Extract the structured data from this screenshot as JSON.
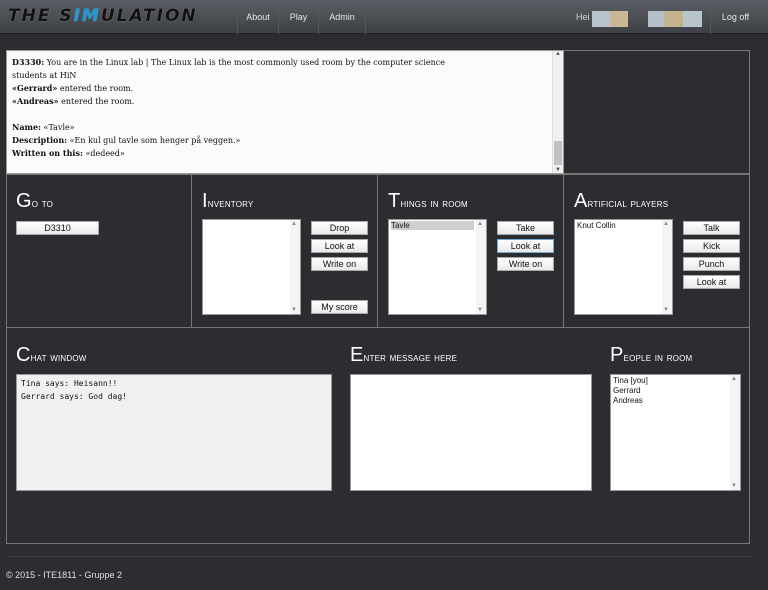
{
  "nav": {
    "brand_prefix": "THE S",
    "brand_accent": "IM",
    "brand_suffix": "ULATION",
    "items": [
      "About",
      "Play",
      "Admin"
    ],
    "greeting": "Hei",
    "logoff": "Log off"
  },
  "log": {
    "lines": [
      {
        "label": "D3330:",
        "text": " You are in the Linux lab | The Linux lab is the most commonly used room by the computer science"
      },
      {
        "label": "",
        "text": "students at HiN"
      },
      {
        "label": "«Gerrard»",
        "text": " entered the room."
      },
      {
        "label": "«Andreas»",
        "text": " entered the room."
      },
      {
        "label": "",
        "text": ""
      },
      {
        "label": "Name:",
        "text": " «Tavle»"
      },
      {
        "label": "Description:",
        "text": " «En kul gul tavle som henger på veggen.»"
      },
      {
        "label": "Written on this:",
        "text": " «dedeed»"
      }
    ]
  },
  "goto": {
    "title": "Go to",
    "destinations": [
      "D3310"
    ]
  },
  "inventory": {
    "title": "Inventory",
    "items": [],
    "buttons": {
      "drop": "Drop",
      "look_at": "Look at",
      "write_on": "Write on",
      "my_score": "My score"
    }
  },
  "things": {
    "title": "Things in room",
    "items": [
      "Tavle"
    ],
    "selected": "Tavle",
    "buttons": {
      "take": "Take",
      "look_at": "Look at",
      "write_on": "Write on"
    }
  },
  "ai_players": {
    "title": "Artificial players",
    "items": [
      "Knut Collin"
    ],
    "buttons": {
      "talk": "Talk",
      "kick": "Kick",
      "punch": "Punch",
      "look_at": "Look at"
    }
  },
  "chat": {
    "title": "Chat window",
    "lines": [
      "Tina says: Heisann!!",
      "Gerrard says: God dag!"
    ]
  },
  "message": {
    "title": "Enter message here",
    "value": ""
  },
  "people": {
    "title": "People in room",
    "items": [
      "Tina [you]",
      "Gerrard",
      "Andreas"
    ]
  },
  "footer": "© 2015 - ITE1811 - Gruppe 2",
  "colors": {
    "background": "#2b2d31",
    "accent": "#1a9be0"
  }
}
